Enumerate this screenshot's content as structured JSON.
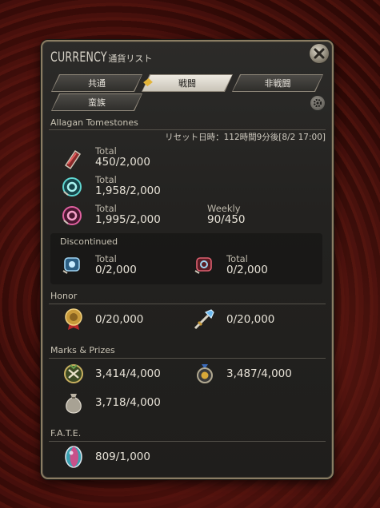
{
  "window": {
    "title": "CURRENCY",
    "subtitle": "通貨リスト"
  },
  "tabs": [
    {
      "label": "共通",
      "active": false
    },
    {
      "label": "戦闘",
      "active": true
    },
    {
      "label": "非戦闘",
      "active": false
    },
    {
      "label": "蛮族",
      "active": false
    }
  ],
  "tomestones": {
    "title": "Allagan Tomestones",
    "reset_text": "リセット日時：112時間9分後[8/2 17:00]",
    "rows": [
      {
        "label": "Total",
        "value": "450/2,000",
        "icon": "tomestone-red-icon"
      },
      {
        "label": "Total",
        "value": "1,958/2,000",
        "icon": "tomestone-teal-icon"
      },
      {
        "label": "Total",
        "value": "1,995/2,000",
        "icon": "tomestone-pink-icon",
        "weekly_label": "Weekly",
        "weekly_value": "90/450"
      }
    ]
  },
  "discontinued": {
    "title": "Discontinued",
    "items": [
      {
        "label": "Total",
        "value": "0/2,000",
        "icon": "tomestone-blue-icon"
      },
      {
        "label": "Total",
        "value": "0/2,000",
        "icon": "tomestone-crimson-icon"
      }
    ]
  },
  "honor": {
    "title": "Honor",
    "items": [
      {
        "value": "0/20,000",
        "icon": "honor-medal-icon"
      },
      {
        "value": "0/20,000",
        "icon": "crystal-sword-icon"
      }
    ]
  },
  "marks": {
    "title": "Marks & Prizes",
    "items": [
      {
        "value": "3,414/4,000",
        "icon": "wolf-mark-icon"
      },
      {
        "value": "3,487/4,000",
        "icon": "trophy-medal-icon"
      },
      {
        "value": "3,718/4,000",
        "icon": "coin-bag-icon"
      }
    ]
  },
  "fate": {
    "title": "F.A.T.E.",
    "items": [
      {
        "value": "809/1,000",
        "icon": "bicolor-gemstone-icon"
      }
    ]
  },
  "colors": {
    "accent": "#e2b43a",
    "frame": "#8a7d63",
    "text": "#e6e1d6"
  }
}
